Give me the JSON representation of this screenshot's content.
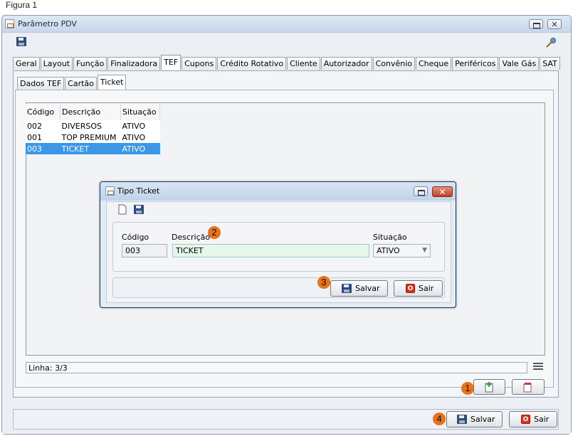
{
  "caption": "Figura 1",
  "window": {
    "title": "Parâmetro PDV",
    "key_icon": "key-icon",
    "save_icon": "save-icon"
  },
  "main_tabs": [
    "Geral",
    "Layout",
    "Função",
    "Finalizadora",
    "TEF",
    "Cupons",
    "Crédito Rotativo",
    "Cliente",
    "Autorizador",
    "Convênio",
    "Cheque",
    "Periféricos",
    "Vale Gás",
    "SAT"
  ],
  "active_main_tab": "TEF",
  "sub_tabs": [
    "Dados TEF",
    "Cartão",
    "Ticket"
  ],
  "active_sub_tab": "Ticket",
  "grid": {
    "headers": [
      "Código",
      "Descrição",
      "Situação"
    ],
    "rows": [
      [
        "002",
        "DIVERSOS",
        "ATIVO"
      ],
      [
        "001",
        "TOP PREMIUM",
        "ATIVO"
      ],
      [
        "003",
        "TICKET",
        "ATIVO"
      ]
    ],
    "selected_row": 2
  },
  "status": {
    "line": "Linha: 3/3"
  },
  "dialog": {
    "title": "Tipo Ticket",
    "labels": {
      "codigo": "Código",
      "descricao": "Descrição",
      "situacao": "Situação"
    },
    "values": {
      "codigo": "003",
      "descricao": "TICKET",
      "situacao": "ATIVO"
    },
    "save_label": "Salvar",
    "exit_label": "Sair"
  },
  "footer": {
    "save_label": "Salvar",
    "exit_label": "Sair"
  },
  "badges": {
    "one": "1",
    "two": "2",
    "three": "3",
    "four": "4"
  },
  "colors": {
    "selection": "#3d97e8",
    "badge": "#e8731a",
    "close": "#c53b22"
  }
}
